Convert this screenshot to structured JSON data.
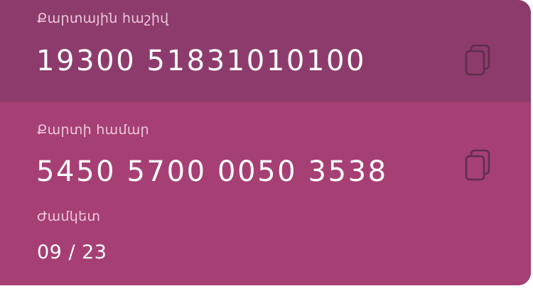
{
  "account": {
    "label": "Քարտային հաշիվ",
    "number": "19300 51831010100"
  },
  "card": {
    "label": "Քարտի համար",
    "number": "5450 5700 0050 3538"
  },
  "expiry": {
    "label": "Ժամկետ",
    "value": "09 / 23"
  },
  "icons": {
    "copy": "copy-icon"
  },
  "colors": {
    "account_bg": "#8d3b6c",
    "card_bg": "#a63f74",
    "label": "#ecc8da",
    "text": "#ffffff",
    "icon": "#5e2f4d"
  }
}
